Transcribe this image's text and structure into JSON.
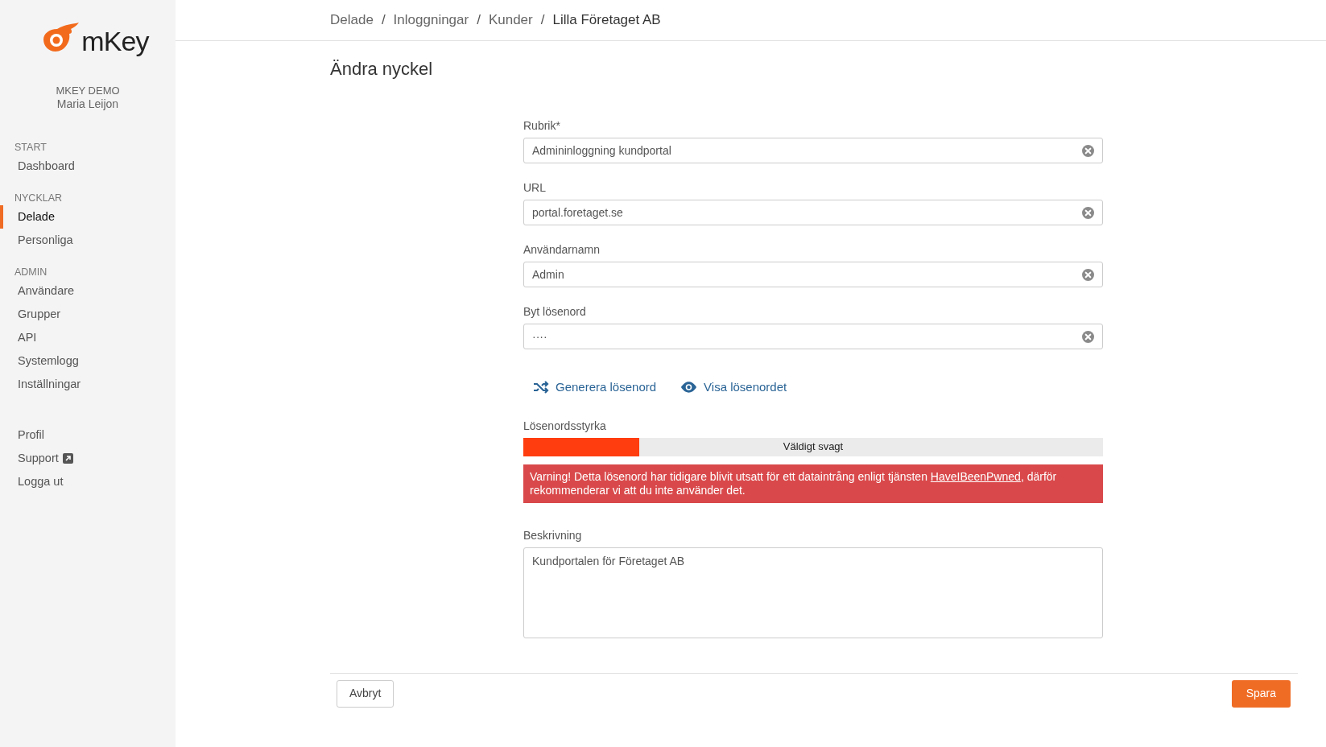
{
  "sidebar": {
    "logo": "mKey",
    "org": "MKEY DEMO",
    "user": "Maria Leijon",
    "sections": [
      {
        "heading": "START",
        "items": [
          {
            "label": "Dashboard",
            "selected": false
          }
        ]
      },
      {
        "heading": "NYCKLAR",
        "items": [
          {
            "label": "Delade",
            "selected": true
          },
          {
            "label": "Personliga",
            "selected": false
          }
        ]
      },
      {
        "heading": "ADMIN",
        "items": [
          {
            "label": "Användare",
            "selected": false
          },
          {
            "label": "Grupper",
            "selected": false
          },
          {
            "label": "API",
            "selected": false
          },
          {
            "label": "Systemlogg",
            "selected": false
          },
          {
            "label": "Inställningar",
            "selected": false
          }
        ]
      },
      {
        "items": [
          {
            "label": "Profil",
            "selected": false
          },
          {
            "label": "Support",
            "selected": false,
            "external": true
          },
          {
            "label": "Logga ut",
            "selected": false
          }
        ]
      }
    ]
  },
  "breadcrumb": {
    "separator": "/",
    "items": [
      "Delade",
      "Inloggningar",
      "Kunder",
      "Lilla Företaget AB"
    ]
  },
  "title": "Ändra nyckel",
  "fields": [
    {
      "label": "Rubrik*",
      "value": "Admininloggning kundportal"
    },
    {
      "label": "URL",
      "value": "portal.foretaget.se"
    },
    {
      "label": "Användarnamn",
      "value": "Admin"
    },
    {
      "label": "Byt lösenord",
      "value": "····"
    }
  ],
  "actions": [
    {
      "kind": "shuffle",
      "label": "Generera lösenord"
    },
    {
      "kind": "eye",
      "label": "Visa lösenordet"
    }
  ],
  "strength": {
    "label": "Lösenordsstyrka",
    "level": 0.2,
    "reading": "Väldigt svagt"
  },
  "warning": {
    "before": "Varning! Detta lösenord har tidigare blivit utsatt för ett dataintrång enligt tjänsten ",
    "link": "HaveIBeenPwned",
    "after": ", därför rekommenderar vi att du inte använder det."
  },
  "description": {
    "label": "Beskrivning",
    "value": "Kundportalen för Företaget AB"
  },
  "footer": {
    "cancel": "Avbryt",
    "save": "Spara"
  }
}
